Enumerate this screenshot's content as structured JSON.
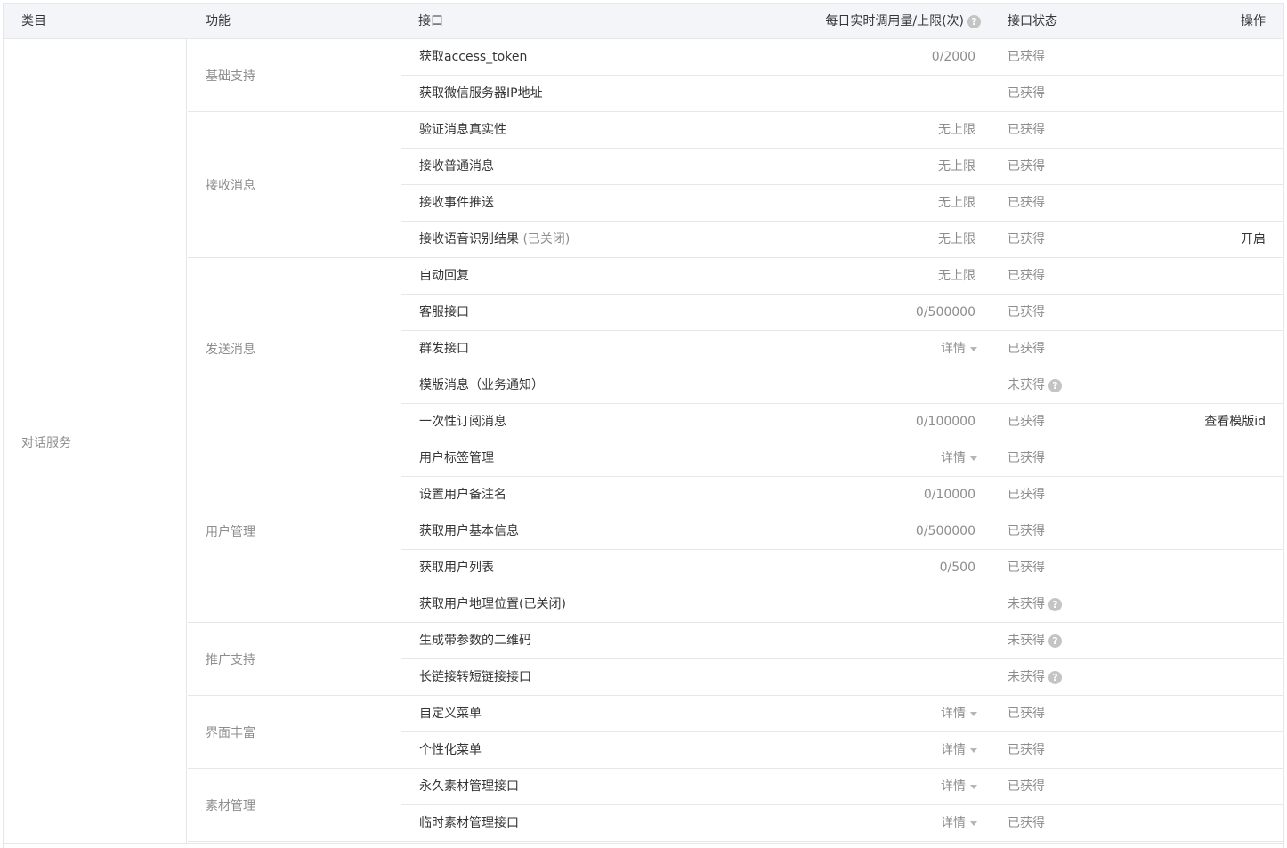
{
  "header": {
    "category": "类目",
    "feature": "功能",
    "api": "接口",
    "quota": "每日实时调用量/上限(次)",
    "status": "接口状态",
    "operation": "操作"
  },
  "category": "对话服务",
  "groups": [
    {
      "label": "基础支持",
      "rows": [
        {
          "name": "获取access_token",
          "quota": "0/2000",
          "status": "已获得"
        },
        {
          "name": "获取微信服务器IP地址",
          "quota": "",
          "status": "已获得"
        }
      ]
    },
    {
      "label": "接收消息",
      "rows": [
        {
          "name": "验证消息真实性",
          "quota": "无上限",
          "status": "已获得"
        },
        {
          "name": "接收普通消息",
          "quota": "无上限",
          "status": "已获得"
        },
        {
          "name": "接收事件推送",
          "quota": "无上限",
          "status": "已获得"
        },
        {
          "name": "接收语音识别结果",
          "note": "(已关闭)",
          "quota": "无上限",
          "status": "已获得",
          "op": "开启"
        }
      ]
    },
    {
      "label": "发送消息",
      "rows": [
        {
          "name": "自动回复",
          "quota": "无上限",
          "status": "已获得"
        },
        {
          "name": "客服接口",
          "quota": "0/500000",
          "status": "已获得"
        },
        {
          "name": "群发接口",
          "quota": "详情",
          "dropdown": true,
          "status": "已获得"
        },
        {
          "name": "模版消息（业务通知）",
          "quota": "",
          "status": "未获得",
          "help": true
        },
        {
          "name": "一次性订阅消息",
          "quota": "0/100000",
          "status": "已获得",
          "op": "查看模版id"
        }
      ]
    },
    {
      "label": "用户管理",
      "rows": [
        {
          "name": "用户标签管理",
          "quota": "详情",
          "dropdown": true,
          "status": "已获得"
        },
        {
          "name": "设置用户备注名",
          "quota": "0/10000",
          "status": "已获得"
        },
        {
          "name": "获取用户基本信息",
          "quota": "0/500000",
          "status": "已获得"
        },
        {
          "name": "获取用户列表",
          "quota": "0/500",
          "status": "已获得"
        },
        {
          "name": "获取用户地理位置(已关闭)",
          "quota": "",
          "status": "未获得",
          "help": true
        }
      ]
    },
    {
      "label": "推广支持",
      "rows": [
        {
          "name": "生成带参数的二维码",
          "quota": "",
          "status": "未获得",
          "help": true
        },
        {
          "name": "长链接转短链接接口",
          "quota": "",
          "status": "未获得",
          "help": true
        }
      ]
    },
    {
      "label": "界面丰富",
      "rows": [
        {
          "name": "自定义菜单",
          "quota": "详情",
          "dropdown": true,
          "status": "已获得"
        },
        {
          "name": "个性化菜单",
          "quota": "详情",
          "dropdown": true,
          "status": "已获得"
        }
      ]
    },
    {
      "label": "素材管理",
      "rows": [
        {
          "name": "永久素材管理接口",
          "quota": "详情",
          "dropdown": true,
          "status": "已获得"
        },
        {
          "name": "临时素材管理接口",
          "quota": "详情",
          "dropdown": true,
          "status": "已获得"
        }
      ]
    }
  ],
  "icons": {
    "help": "question-circle-icon",
    "dropdown": "caret-down-icon"
  }
}
